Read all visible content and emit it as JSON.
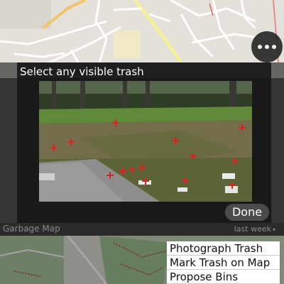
{
  "dialog": {
    "title": "Select any visible trash",
    "done_label": "Done"
  },
  "map": {
    "more_button": {
      "icon": "more-horizontal-icon"
    }
  },
  "garbage_bar": {
    "left_label": "Garbage Map",
    "right_label": "last week",
    "caret": "▾"
  },
  "menu": {
    "items": [
      {
        "label": "Photograph Trash"
      },
      {
        "label": "Mark Trash on Map"
      },
      {
        "label": "Propose Bins"
      }
    ]
  },
  "colors": {
    "marker": "#e02020",
    "dialog_bg": "#161616",
    "road": "#ffffff",
    "major_road": "#f5e27a"
  }
}
